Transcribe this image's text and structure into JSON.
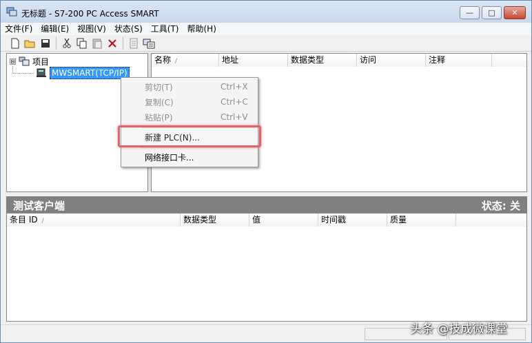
{
  "window": {
    "title": "无标题 - S7-200 PC Access SMART",
    "controls": {
      "minimize": "—",
      "maximize": "□",
      "close": "✕"
    }
  },
  "menu": [
    "文件(F)",
    "编辑(E)",
    "视图(V)",
    "状态(S)",
    "工具(T)",
    "帮助(H)"
  ],
  "toolbar": {
    "buttons": [
      "new-file-icon",
      "open-folder-icon",
      "save-icon",
      "cut-icon",
      "copy-icon",
      "paste-icon",
      "delete-icon",
      "properties-icon",
      "plc-icon"
    ]
  },
  "tree": {
    "root_label": "项目",
    "expander": "⊟",
    "child_label": "MWSMART(TCP/IP)"
  },
  "item_list": {
    "columns": [
      "名称",
      "地址",
      "数据类型",
      "访问",
      "注释"
    ],
    "sort_indicator": "/"
  },
  "test_client": {
    "title": "测试客户端",
    "status": "状态:  关"
  },
  "client_list": {
    "columns": [
      "条目 ID",
      "数据类型",
      "值",
      "时间戳",
      "质量"
    ],
    "sort_indicator": "/"
  },
  "context_menu": {
    "items": [
      {
        "label": "剪切(T)",
        "shortcut": "Ctrl+X",
        "disabled": true
      },
      {
        "label": "复制(C)",
        "shortcut": "Ctrl+C",
        "disabled": true
      },
      {
        "label": "粘贴(P)",
        "shortcut": "Ctrl+V",
        "disabled": true
      },
      {
        "label": "新建 PLC(N)...",
        "shortcut": "",
        "disabled": false,
        "highlighted": true
      },
      {
        "label": "网络接口卡...",
        "shortcut": "",
        "disabled": false
      }
    ]
  },
  "watermark": "头条 @技成微课堂",
  "colors": {
    "highlight_border": "#e0626b",
    "selection": "#3399ff",
    "client_bar": "#808080"
  }
}
